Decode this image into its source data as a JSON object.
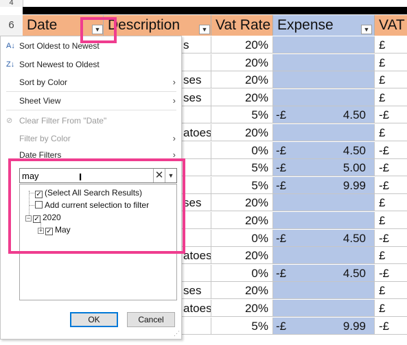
{
  "sheet": {
    "row_numbers": [
      "4",
      "6"
    ],
    "headers": {
      "date": "Date",
      "description": "Description",
      "vat_rate": "Vat Rate",
      "expense": "Expense",
      "vat": "VAT"
    },
    "desc_fragments": [
      "s",
      "",
      "ses",
      "ses",
      "",
      "atoes",
      "",
      "",
      "",
      "ses",
      "",
      "",
      "atoes",
      "",
      "ses",
      "atoes",
      ""
    ],
    "vat_rates": [
      "20%",
      "20%",
      "20%",
      "20%",
      "5%",
      "20%",
      "0%",
      "5%",
      "5%",
      "20%",
      "20%",
      "0%",
      "20%",
      "0%",
      "20%",
      "20%",
      "5%"
    ],
    "expense_prefix": [
      "",
      "",
      "",
      "",
      "-£",
      "",
      "-£",
      "-£",
      "-£",
      "",
      "",
      "-£",
      "",
      "-£",
      "",
      "",
      "-£"
    ],
    "expense_values": [
      "",
      "",
      "",
      "",
      "4.50",
      "",
      "4.50",
      "5.00",
      "9.99",
      "",
      "",
      "4.50",
      "",
      "4.50",
      "",
      "",
      "9.99"
    ],
    "vat_prefix": [
      "£",
      "£",
      "£",
      "£",
      "-£",
      "£",
      "-£",
      "-£",
      "-£",
      "£",
      "£",
      "-£",
      "£",
      "-£",
      "£",
      "£",
      "-£"
    ]
  },
  "menu": {
    "sort_oldest": "Sort Oldest to Newest",
    "sort_newest": "Sort Newest to Oldest",
    "sort_by_color": "Sort by Color",
    "sheet_view": "Sheet View",
    "clear_filter": "Clear Filter From \"Date\"",
    "filter_by_color": "Filter by Color",
    "date_filters": "Date Filters",
    "search_value": "may",
    "tree": {
      "select_all": "(Select All Search Results)",
      "add_current": "Add current selection to filter",
      "year": "2020",
      "month": "May"
    },
    "ok": "OK",
    "cancel": "Cancel"
  },
  "colors": {
    "highlight": "#ef3d8f",
    "header_fill": "#f4b183",
    "expense_fill": "#b4c6e7"
  }
}
